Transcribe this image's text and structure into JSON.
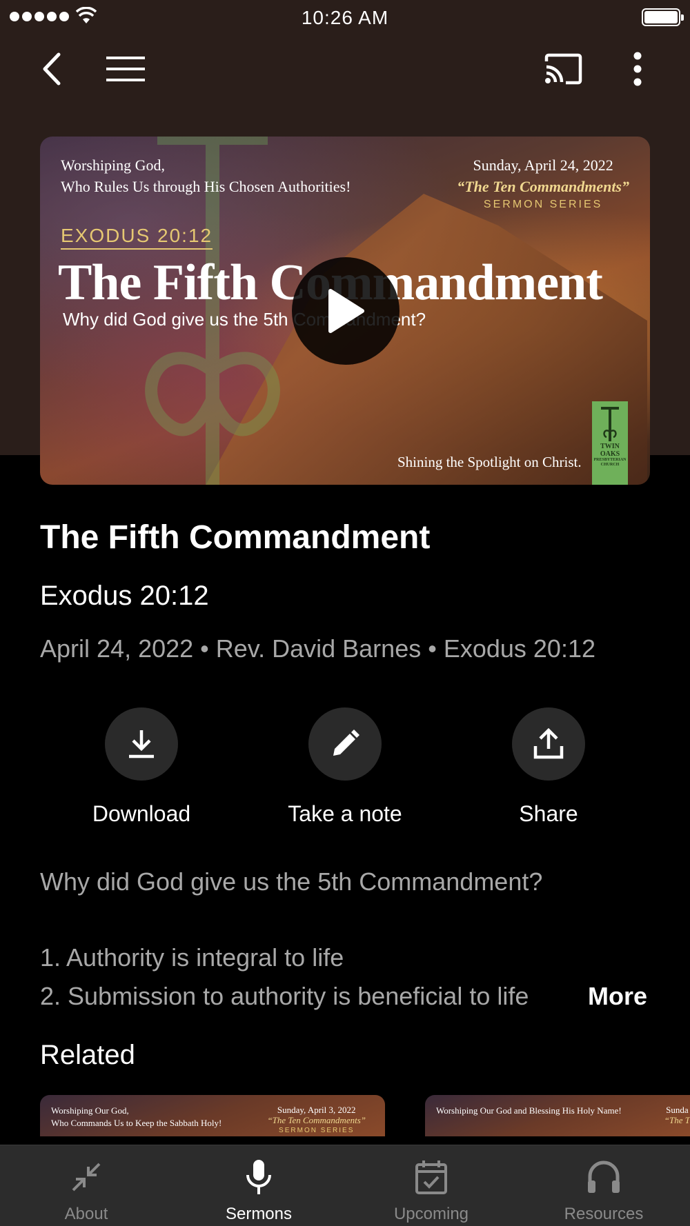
{
  "status_bar": {
    "time": "10:26 AM"
  },
  "hero": {
    "left_subtitle_1": "Worshiping  God,",
    "left_subtitle_2": "Who Rules Us through His Chosen Authorities!",
    "date": "Sunday, April 24, 2022",
    "series_name": "“The Ten Commandments”",
    "series_label": "SERMON SERIES",
    "scripture": "EXODUS 20:12",
    "big_title": "The Fifth Commandment",
    "question": "Why did God give us the 5th Commandment?",
    "tagline": "Shining the Spotlight on Christ.",
    "logo_text": "TWIN OAKS",
    "logo_sub": "PRESBYTERIAN CHURCH"
  },
  "sermon": {
    "title": "The Fifth Commandment",
    "subtitle": "Exodus 20:12",
    "meta": "April 24, 2022 • Rev. David Barnes • Exodus 20:12"
  },
  "actions": {
    "download": "Download",
    "note": "Take a note",
    "share": "Share"
  },
  "description": {
    "line1": "Why did God give us the 5th Commandment?",
    "line2": "1. Authority is integral to life",
    "line3": "2. Submission to authority is beneficial to life",
    "more": "More"
  },
  "related": {
    "heading": "Related",
    "cards": [
      {
        "left_1": "Worshiping Our God,",
        "left_2": "Who Commands Us to Keep the Sabbath Holy!",
        "date": "Sunday, April 3, 2022",
        "series": "“The Ten Commandments”",
        "label": "SERMON SERIES"
      },
      {
        "left_1": "Worshiping Our God and Blessing His Holy Name!",
        "left_2": "",
        "date": "Sunda",
        "series": "“The T",
        "label": ""
      }
    ]
  },
  "tabs": [
    {
      "label": "About",
      "icon": "collapse-arrows-icon"
    },
    {
      "label": "Sermons",
      "icon": "microphone-icon"
    },
    {
      "label": "Upcoming",
      "icon": "calendar-icon"
    },
    {
      "label": "Resources",
      "icon": "headphones-icon"
    }
  ],
  "colors": {
    "header_bg": "#2a1e1a",
    "accent_gold": "#e6c872",
    "tabbar_bg": "#2c2c2c",
    "muted_text": "#a8a8a8"
  }
}
